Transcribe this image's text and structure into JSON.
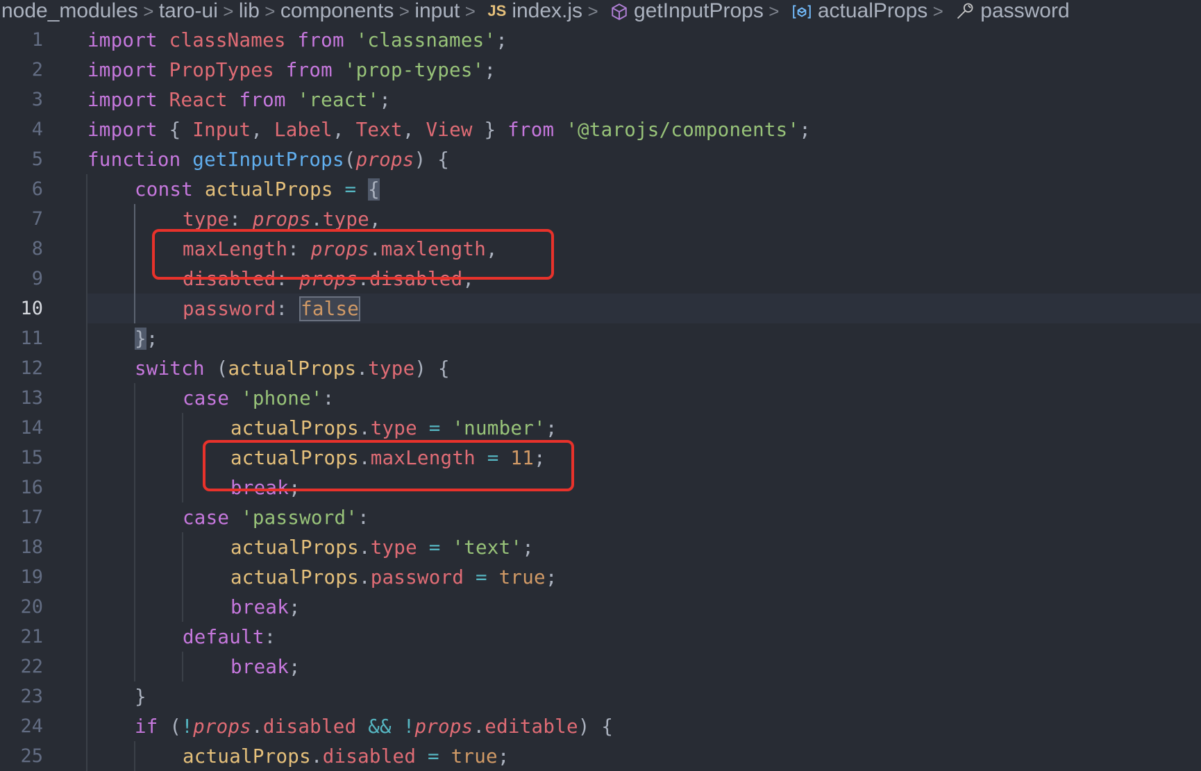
{
  "breadcrumb": {
    "items": [
      {
        "label": "node_modules"
      },
      {
        "label": "taro-ui"
      },
      {
        "label": "lib"
      },
      {
        "label": "components"
      },
      {
        "label": "input"
      },
      {
        "label": "index.js",
        "icon": "js-file-icon",
        "icon_text": "JS"
      },
      {
        "label": "getInputProps",
        "icon": "cube-icon"
      },
      {
        "label": "actualProps",
        "icon": "variable-icon"
      },
      {
        "label": "password",
        "icon": "wrench-icon"
      }
    ],
    "separator": ">"
  },
  "editor": {
    "current_line": 10,
    "lines": [
      {
        "n": "1"
      },
      {
        "n": "2"
      },
      {
        "n": "3"
      },
      {
        "n": "4"
      },
      {
        "n": "5"
      },
      {
        "n": "6"
      },
      {
        "n": "7"
      },
      {
        "n": "8"
      },
      {
        "n": "9"
      },
      {
        "n": "10"
      },
      {
        "n": "11"
      },
      {
        "n": "12"
      },
      {
        "n": "13"
      },
      {
        "n": "14"
      },
      {
        "n": "15"
      },
      {
        "n": "16"
      },
      {
        "n": "17"
      },
      {
        "n": "18"
      },
      {
        "n": "19"
      },
      {
        "n": "20"
      },
      {
        "n": "21"
      },
      {
        "n": "22"
      },
      {
        "n": "23"
      },
      {
        "n": "24"
      },
      {
        "n": "25"
      }
    ],
    "tokens": {
      "l1": [
        "import",
        " classNames ",
        "from",
        " 'classnames'",
        ";"
      ],
      "l2": [
        "import",
        " PropTypes ",
        "from",
        " 'prop-types'",
        ";"
      ],
      "l3": [
        "import",
        " React ",
        "from",
        " 'react'",
        ";"
      ],
      "l4": [
        "import",
        " { ",
        "Input",
        ", ",
        "Label",
        ", ",
        "Text",
        ", ",
        "View",
        " } ",
        "from",
        " '@tarojs/components'",
        ";"
      ],
      "l5": [
        "function",
        " ",
        "getInputProps",
        "(",
        "props",
        ") {"
      ],
      "l6": [
        "const",
        " ",
        "actualProps",
        " ",
        "=",
        " ",
        "{"
      ],
      "l7": [
        "type",
        ": ",
        "props",
        ".",
        "type",
        ","
      ],
      "l8": [
        "maxLength",
        ": ",
        "props",
        ".",
        "maxlength",
        ","
      ],
      "l9": [
        "disabled",
        ": ",
        "props",
        ".",
        "disabled",
        ","
      ],
      "l10": [
        "password",
        ": ",
        "false"
      ],
      "l11": [
        "}",
        ";"
      ],
      "l12": [
        "switch",
        " (",
        "actualProps",
        ".",
        "type",
        ") {"
      ],
      "l13": [
        "case",
        " ",
        "'phone'",
        ":"
      ],
      "l14": [
        "actualProps",
        ".",
        "type",
        " ",
        "=",
        " ",
        "'number'",
        ";"
      ],
      "l15": [
        "actualProps",
        ".",
        "maxLength",
        " ",
        "=",
        " ",
        "11",
        ";"
      ],
      "l16": [
        "break",
        ";"
      ],
      "l17": [
        "case",
        " ",
        "'password'",
        ":"
      ],
      "l18": [
        "actualProps",
        ".",
        "type",
        " ",
        "=",
        " ",
        "'text'",
        ";"
      ],
      "l19": [
        "actualProps",
        ".",
        "password",
        " ",
        "=",
        " ",
        "true",
        ";"
      ],
      "l20": [
        "break",
        ";"
      ],
      "l21": [
        "default",
        ":"
      ],
      "l22": [
        "break",
        ";"
      ],
      "l23": [
        "}"
      ],
      "l24": [
        "if",
        " (",
        "!",
        "props",
        ".",
        "disabled",
        " ",
        "&&",
        " ",
        "!",
        "props",
        ".",
        "editable",
        ") {"
      ],
      "l25": [
        "actualProps",
        ".",
        "disabled",
        " ",
        "=",
        " ",
        "true",
        ";"
      ]
    }
  },
  "colors": {
    "background": "#282c34",
    "annotation": "#e8322b",
    "keyword": "#c678dd",
    "string": "#98c379",
    "variable": "#e5c07b",
    "function": "#61afef",
    "property": "#e06c75",
    "number": "#d19a66"
  }
}
